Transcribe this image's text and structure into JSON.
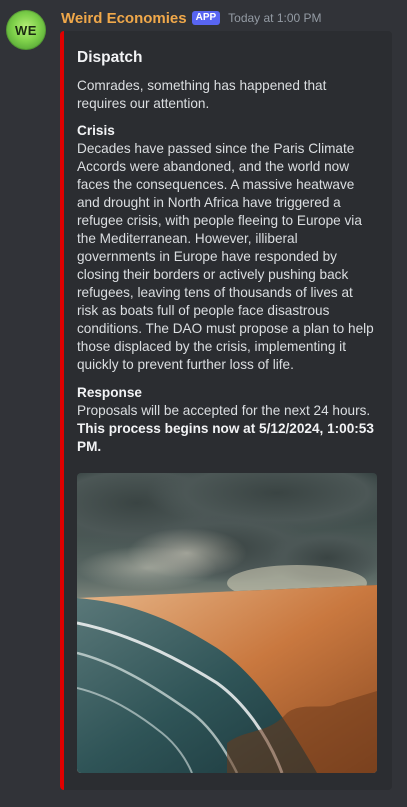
{
  "message": {
    "avatar_initials": "WE",
    "author": "Weird Economies",
    "badge": "APP",
    "timestamp": "Today at 1:00 PM"
  },
  "embed": {
    "accent_color": "#e00000",
    "title": "Dispatch",
    "description": "Comrades, something has happened that requires our attention.",
    "fields": [
      {
        "name": "Crisis",
        "value": "Decades have passed since the Paris Climate Accords were abandoned, and the world now faces the consequences. A massive heatwave and drought in North Africa have triggered a refugee crisis, with people fleeing to Europe via the Mediterranean. However, illiberal governments in Europe have responded by closing their borders or actively pushing back refugees, leaving tens of thousands of lives at risk as boats full of people face disastrous conditions. The DAO must propose a plan to help those displaced by the crisis, implementing it quickly to prevent further loss of life."
      },
      {
        "name": "Response",
        "value": "Proposals will be accepted for the next 24 hours.",
        "value_bold": "This process begins now at 5/12/2024, 1:00:53 PM."
      }
    ]
  }
}
